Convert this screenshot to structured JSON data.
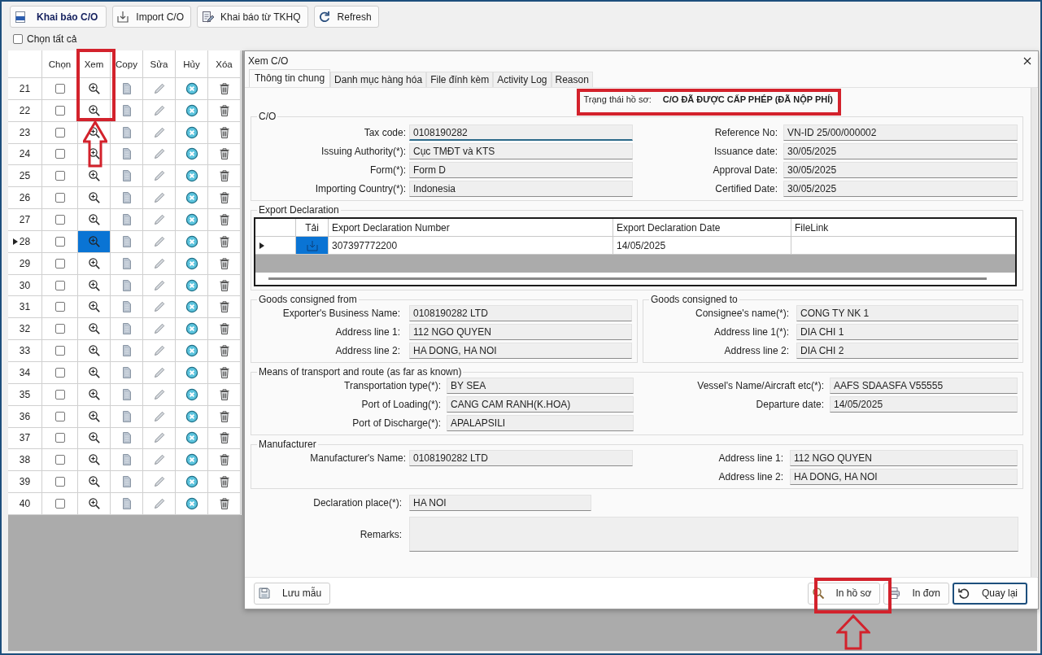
{
  "toolbar": [
    {
      "label": "Khai báo C/O",
      "kind": "new"
    },
    {
      "label": "Import C/O",
      "kind": "import"
    },
    {
      "label": "Khai báo từ TKHQ",
      "kind": "declare"
    },
    {
      "label": "Refresh",
      "kind": "refresh"
    }
  ],
  "select_all": {
    "label": "Chọn tất cả",
    "checked": false
  },
  "grid": {
    "columns": [
      "Chọn",
      "Xem",
      "Copy",
      "Sửa",
      "Hủy",
      "Xóa"
    ],
    "rows": [
      {
        "number": "21",
        "checked": false,
        "selected": false
      },
      {
        "number": "22",
        "checked": false,
        "selected": false
      },
      {
        "number": "23",
        "checked": false,
        "selected": false
      },
      {
        "number": "24",
        "checked": false,
        "selected": false
      },
      {
        "number": "25",
        "checked": false,
        "selected": false
      },
      {
        "number": "26",
        "checked": false,
        "selected": false
      },
      {
        "number": "27",
        "checked": false,
        "selected": false
      },
      {
        "number": "28",
        "checked": false,
        "selected": true
      },
      {
        "number": "29",
        "checked": false,
        "selected": false
      },
      {
        "number": "30",
        "checked": false,
        "selected": false
      },
      {
        "number": "31",
        "checked": false,
        "selected": false
      },
      {
        "number": "32",
        "checked": false,
        "selected": false
      },
      {
        "number": "33",
        "checked": false,
        "selected": false
      },
      {
        "number": "34",
        "checked": false,
        "selected": false
      },
      {
        "number": "35",
        "checked": false,
        "selected": false
      },
      {
        "number": "36",
        "checked": false,
        "selected": false
      },
      {
        "number": "37",
        "checked": false,
        "selected": false
      },
      {
        "number": "38",
        "checked": false,
        "selected": false
      },
      {
        "number": "39",
        "checked": false,
        "selected": false
      },
      {
        "number": "40",
        "checked": false,
        "selected": false
      }
    ]
  },
  "dialog": {
    "title": "Xem C/O",
    "tabs": [
      {
        "label": "Thông tin chung",
        "selected": true
      },
      {
        "label": "Danh mục hàng hóa",
        "selected": false
      },
      {
        "label": "File đính kèm",
        "selected": false
      },
      {
        "label": "Activity Log",
        "selected": false
      },
      {
        "label": "Reason",
        "selected": false
      }
    ],
    "status": {
      "label": "Trạng thái hồ sơ:",
      "value": "C/O ĐÃ ĐƯỢC CẤP PHÉP (ĐÃ NỘP PHÍ)"
    },
    "co": {
      "title": "C/O",
      "left": [
        {
          "label": "Tax code:",
          "value": "0108190282",
          "focused": true
        },
        {
          "label": "Issuing Authority(*):",
          "value": "Cục TMĐT và KTS",
          "focused": false
        },
        {
          "label": "Form(*):",
          "value": "Form D",
          "focused": false
        },
        {
          "label": "Importing Country(*):",
          "value": "Indonesia",
          "focused": false
        }
      ],
      "right": [
        {
          "label": "Reference No:",
          "value": "VN-ID 25/00/000002",
          "focused": false
        },
        {
          "label": "Issuance date:",
          "value": "30/05/2025",
          "focused": false
        },
        {
          "label": "Approval Date:",
          "value": "30/05/2025",
          "focused": false
        },
        {
          "label": "Certified Date:",
          "value": "30/05/2025",
          "focused": false
        }
      ]
    },
    "export_declaration": {
      "title": "Export Declaration",
      "columns": [
        "Tải",
        "Export Declaration Number",
        "Export Declaration Date",
        "FileLink"
      ],
      "rows": [
        {
          "number": "307397772200",
          "date": "14/05/2025",
          "selected": true
        }
      ]
    },
    "goods_from": {
      "title": "Goods consigned from",
      "fields": [
        {
          "label": "Exporter's Business Name:",
          "value": "0108190282 LTD"
        },
        {
          "label": "Address line 1:",
          "value": "112 NGO QUYEN"
        },
        {
          "label": "Address line 2:",
          "value": "HA DONG, HA NOI"
        }
      ]
    },
    "goods_to": {
      "title": "Goods consigned to",
      "fields": [
        {
          "label": "Consignee's name(*):",
          "value": "CONG TY NK 1"
        },
        {
          "label": "Address line 1(*):",
          "value": "DIA CHI 1"
        },
        {
          "label": "Address line 2:",
          "value": "DIA CHI 2"
        }
      ]
    },
    "transport": {
      "title": "Means of transport and route (as far as known)",
      "left": [
        {
          "label": "Transportation type(*):",
          "value": "BY SEA"
        },
        {
          "label": "Port of Loading(*):",
          "value": "CANG CAM RANH(K.HOA)"
        },
        {
          "label": "Port of Discharge(*):",
          "value": "APALAPSILI"
        }
      ],
      "right": [
        {
          "label": "Vessel's Name/Aircraft etc(*):",
          "value": "AAFS SDAASFA V55555"
        },
        {
          "label": "Departure date:",
          "value": "14/05/2025"
        }
      ]
    },
    "manufacturer": {
      "title": "Manufacturer",
      "left": [
        {
          "label": "Manufacturer's Name:",
          "value": "0108190282 LTD"
        }
      ],
      "right": [
        {
          "label": "Address line 1:",
          "value": "112 NGO QUYEN"
        },
        {
          "label": "Address line 2:",
          "value": "HA DONG, HA NOI"
        }
      ]
    },
    "declaration_place": {
      "label": "Declaration place(*):",
      "value": "HA NOI"
    },
    "remarks": {
      "label": "Remarks:"
    },
    "buttons": [
      {
        "label": "Lưu mẫu",
        "kind": "save",
        "focused": false
      },
      {
        "label": "In hồ sơ",
        "kind": "preview",
        "focused": false
      },
      {
        "label": "In đơn",
        "kind": "print",
        "focused": false
      },
      {
        "label": "Quay lại",
        "kind": "back",
        "focused": true
      }
    ]
  }
}
